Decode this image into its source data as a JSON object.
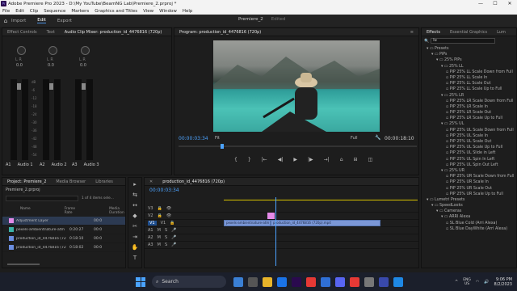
{
  "app": {
    "title": "Adobe Premiere Pro 2023 - D:\\My YouTube\\BeamNG Lab\\Premiere_2.prproj *",
    "min": "—",
    "max": "☐",
    "close": "✕"
  },
  "menu": [
    "File",
    "Edit",
    "Clip",
    "Sequence",
    "Markers",
    "Graphics and Titles",
    "View",
    "Window",
    "Help"
  ],
  "modes": [
    "Import",
    "Edit",
    "Export"
  ],
  "project_name": "Premiere_2",
  "project_status": "Edited",
  "source_tabs": [
    "Effect Controls",
    "Text",
    "Audio Clip Mixer: production_id_4476816 (720p)"
  ],
  "mixer": {
    "channels": [
      "A1",
      "A2",
      "A3"
    ],
    "labels": [
      "Audio 1",
      "Audio 2",
      "Audio 3"
    ],
    "knob_label": "L  R",
    "zero": "0.0",
    "scale": [
      "dB",
      "-6",
      "-12",
      "-18",
      "-24",
      "-30",
      "-36",
      "-42",
      "-48",
      "-54"
    ]
  },
  "program": {
    "tab": "Program: production_id_4476816 (720p)",
    "timecode": "00:00:03:34",
    "fit": "Fit",
    "quality": "Full",
    "duration": "00:00:18:10"
  },
  "transport": [
    "{",
    "}",
    "|←",
    "◀|",
    "▶",
    "|▶",
    "→|",
    "⌂",
    "⊟",
    "◫"
  ],
  "project": {
    "tabs": [
      "Project: Premiere_2",
      "Media Browser",
      "Libraries"
    ],
    "file": "Premiere_2.prproj",
    "count": "1 of 4 items sele...",
    "columns": [
      "Name",
      "Frame Rate",
      "Media Duration"
    ],
    "rows": [
      {
        "name": "Adjustment Layer",
        "fps": "",
        "dur": "00:0",
        "color": "#e48ae8"
      },
      {
        "name": "pexels-ambientnature-atm",
        "fps": "0:20:27",
        "dur": "00:0",
        "color": "#3bb3a7"
      },
      {
        "name": "production_id_4476816 (72",
        "fps": "0:18:10",
        "dur": "00:0",
        "color": "#6b8ee0"
      },
      {
        "name": "production_id_4476816 (72",
        "fps": "0:18:02",
        "dur": "00:0",
        "color": "#6b8ee0"
      }
    ]
  },
  "tools": [
    "▸",
    "⇆",
    "↔",
    "◆",
    "✂",
    "⇥",
    "✋",
    "T"
  ],
  "timeline": {
    "tab": "production_id_4476816 (720p)",
    "timecode": "00:00:03:34",
    "tracks": [
      "V3",
      "V2",
      "V1",
      "A1",
      "A2",
      "A3"
    ],
    "clip_v1a": "pexels-ambientnature-atm",
    "clip_v1b": "production_id_4476816 (720p).mp4",
    "src": "V1"
  },
  "effects": {
    "tabs": [
      "Effects",
      "Essential Graphics",
      "Lum"
    ],
    "search": "lu",
    "rows": [
      {
        "label": "Presets",
        "d": 1,
        "t": "▾"
      },
      {
        "label": "PiPs",
        "d": 2,
        "t": "▾"
      },
      {
        "label": "25% PiPs",
        "d": 3,
        "t": "▾"
      },
      {
        "label": "25% LL",
        "d": 4,
        "t": "▾"
      },
      {
        "label": "PiP 25% LL Scale Down from Full",
        "d": 5
      },
      {
        "label": "PiP 25% LL Scale In",
        "d": 5
      },
      {
        "label": "PiP 25% LL Scale Out",
        "d": 5
      },
      {
        "label": "PiP 25% LL Scale Up to Full",
        "d": 5
      },
      {
        "label": "25% LR",
        "d": 4,
        "t": "▾"
      },
      {
        "label": "PiP 25% LR Scale Down from Full",
        "d": 5
      },
      {
        "label": "PiP 25% LR Scale In",
        "d": 5
      },
      {
        "label": "PiP 25% LR Scale Out",
        "d": 5
      },
      {
        "label": "PiP 25% LR Scale Up to Full",
        "d": 5
      },
      {
        "label": "25% UL",
        "d": 4,
        "t": "▾"
      },
      {
        "label": "PiP 25% UL Scale Down from Full",
        "d": 5
      },
      {
        "label": "PiP 25% UL Scale In",
        "d": 5
      },
      {
        "label": "PiP 25% UL Scale Out",
        "d": 5
      },
      {
        "label": "PiP 25% UL Scale Up to Full",
        "d": 5
      },
      {
        "label": "PiP 25% UL Slide in Left",
        "d": 5
      },
      {
        "label": "PiP 25% UL Spin In Left",
        "d": 5
      },
      {
        "label": "PiP 25% UL Spin Out Left",
        "d": 5
      },
      {
        "label": "25% UR",
        "d": 4,
        "t": "▾"
      },
      {
        "label": "PiP 25% UR Scale Down from Full",
        "d": 5
      },
      {
        "label": "PiP 25% UR Scale In",
        "d": 5
      },
      {
        "label": "PiP 25% UR Scale Out",
        "d": 5
      },
      {
        "label": "PiP 25% UR Scale Up to Full",
        "d": 5
      },
      {
        "label": "Lumetri Presets",
        "d": 1,
        "t": "▾"
      },
      {
        "label": "SpeedLooks",
        "d": 2,
        "t": "▾"
      },
      {
        "label": "Cameras",
        "d": 3,
        "t": "▾"
      },
      {
        "label": "ARRI Alexa",
        "d": 4,
        "t": "▾"
      },
      {
        "label": "SL Blue Cold (Arri Alexa)",
        "d": 5
      },
      {
        "label": "SL Blue DayWhite (Arri Alexa)",
        "d": 5
      }
    ]
  },
  "taskbar": {
    "search": "Search",
    "time": "9:06 PM",
    "date": "8/2/2023",
    "lang": "ENG\nUS",
    "apps": [
      {
        "c": "#3a7fd4"
      },
      {
        "c": "#555"
      },
      {
        "c": "#e8b42a"
      },
      {
        "c": "#1a73e8"
      },
      {
        "c": "#2a0a4e"
      },
      {
        "c": "#e53935"
      },
      {
        "c": "#2f6fd6"
      },
      {
        "c": "#5865f2"
      },
      {
        "c": "#e53935"
      },
      {
        "c": "#777"
      },
      {
        "c": "#3949ab"
      },
      {
        "c": "#1e88e5"
      }
    ]
  },
  "colors": {
    "accent": "#4a8fe0",
    "timecode": "#4ca3ff",
    "adjustment": "#e48ae8",
    "clip": "#7b97d6",
    "playhead": "#4ca3ff"
  }
}
